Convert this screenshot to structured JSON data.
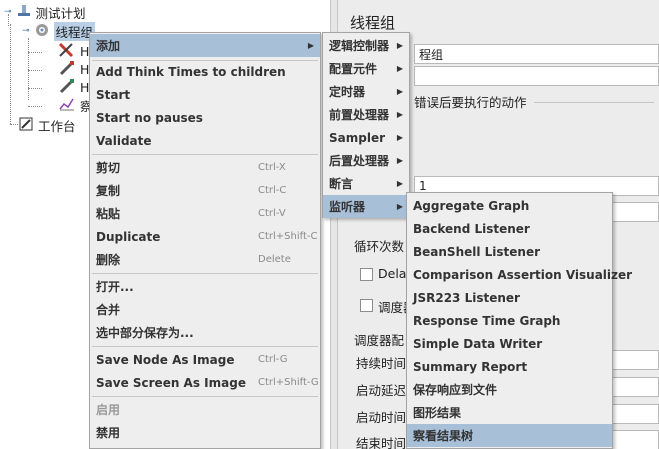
{
  "tree": {
    "root_label": "测试计划",
    "thread_group_label": "线程组",
    "child_labels": [
      "H",
      "H",
      "H",
      "察"
    ],
    "workbench_label": "工作台"
  },
  "panel": {
    "title": "线程组",
    "name_value": "程组",
    "error_action_label": "错误后要执行的动作",
    "threads_value": "1",
    "loop_label": "循环次数",
    "delay_label": "Delay",
    "scheduler_label": "调度器",
    "scheduler_group_label": "调度器配",
    "duration_label": "持续时间",
    "startup_delay_label": "启动延迟",
    "start_time_label": "启动时间",
    "end_time_label": "结束时间"
  },
  "context_menu": {
    "add": "添加",
    "add_think_times": "Add Think Times to children",
    "start": "Start",
    "start_no_pauses": "Start no pauses",
    "validate": "Validate",
    "cut": "剪切",
    "cut_sc": "Ctrl-X",
    "copy": "复制",
    "copy_sc": "Ctrl-C",
    "paste": "粘贴",
    "paste_sc": "Ctrl-V",
    "duplicate": "Duplicate",
    "duplicate_sc": "Ctrl+Shift-C",
    "delete": "删除",
    "delete_sc": "Delete",
    "open": "打开...",
    "merge": "合并",
    "save_selection_as": "选中部分保存为...",
    "save_node_image": "Save Node As Image",
    "save_node_image_sc": "Ctrl-G",
    "save_screen_image": "Save Screen As Image",
    "save_screen_image_sc": "Ctrl+Shift-G",
    "enable": "启用",
    "disable": "禁用"
  },
  "add_submenu": {
    "items": [
      "逻辑控制器",
      "配置元件",
      "定时器",
      "前置处理器",
      "Sampler",
      "后置处理器",
      "断言",
      "监听器"
    ]
  },
  "listener_submenu": {
    "items": [
      "Aggregate Graph",
      "Backend Listener",
      "BeanShell Listener",
      "Comparison Assertion Visualizer",
      "JSR223 Listener",
      "Response Time Graph",
      "Simple Data Writer",
      "Summary Report",
      "保存响应到文件",
      "图形结果",
      "察看结果树"
    ]
  },
  "colors": {
    "highlight": "#a8bfd8",
    "tree_selection": "#b8cfe5",
    "menu_bg": "#eeeeee"
  }
}
